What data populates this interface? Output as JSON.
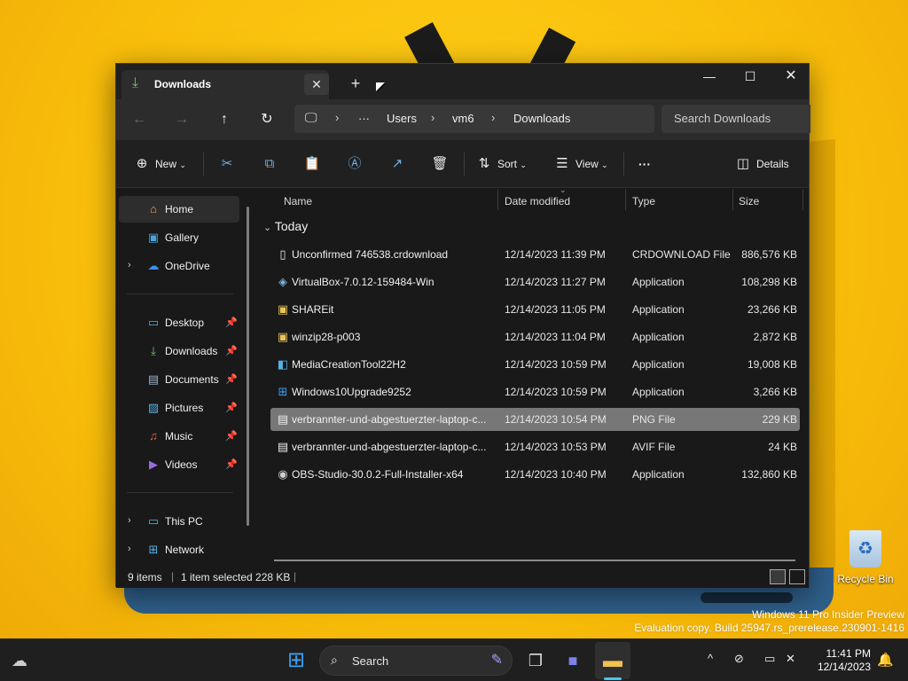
{
  "window": {
    "tab_title": "Downloads",
    "tab_close": "✕",
    "new_tab": "+",
    "minimize": "—",
    "maximize": "☐",
    "close": "✕"
  },
  "nav": {
    "back": "←",
    "forward": "→",
    "up": "↑",
    "refresh": "↻",
    "breadcrumb": [
      "Users",
      "vm6",
      "Downloads"
    ],
    "more": "···",
    "search_placeholder": "Search Downloads"
  },
  "toolbar": {
    "new_label": "New",
    "sort_label": "Sort",
    "view_label": "View",
    "more": "···",
    "details_label": "Details"
  },
  "sidebar": {
    "items": [
      {
        "label": "Home",
        "icon": "home-icon"
      },
      {
        "label": "Gallery",
        "icon": "gallery-icon"
      },
      {
        "label": "OneDrive",
        "icon": "cloud-icon"
      },
      {
        "label": "Desktop",
        "icon": "desktop-icon"
      },
      {
        "label": "Downloads",
        "icon": "download-icon"
      },
      {
        "label": "Documents",
        "icon": "document-icon"
      },
      {
        "label": "Pictures",
        "icon": "picture-icon"
      },
      {
        "label": "Music",
        "icon": "music-icon"
      },
      {
        "label": "Videos",
        "icon": "video-icon"
      },
      {
        "label": "This PC",
        "icon": "pc-icon"
      },
      {
        "label": "Network",
        "icon": "network-icon"
      }
    ]
  },
  "filelist": {
    "columns": [
      "Name",
      "Date modified",
      "Type",
      "Size"
    ],
    "group": "Today",
    "rows": [
      {
        "name": "Unconfirmed 746538.crdownload",
        "date": "12/14/2023 11:39 PM",
        "type": "CRDOWNLOAD File",
        "size": "886,576 KB"
      },
      {
        "name": "VirtualBox-7.0.12-159484-Win",
        "date": "12/14/2023 11:27 PM",
        "type": "Application",
        "size": "108,298 KB"
      },
      {
        "name": "SHAREit",
        "date": "12/14/2023 11:05 PM",
        "type": "Application",
        "size": "23,266 KB"
      },
      {
        "name": "winzip28-p003",
        "date": "12/14/2023 11:04 PM",
        "type": "Application",
        "size": "2,872 KB"
      },
      {
        "name": "MediaCreationTool22H2",
        "date": "12/14/2023 10:59 PM",
        "type": "Application",
        "size": "19,008 KB"
      },
      {
        "name": "Windows10Upgrade9252",
        "date": "12/14/2023 10:59 PM",
        "type": "Application",
        "size": "3,266 KB"
      },
      {
        "name": "verbrannter-und-abgestuerzter-laptop-c...",
        "date": "12/14/2023 10:54 PM",
        "type": "PNG File",
        "size": "229 KB"
      },
      {
        "name": "verbrannter-und-abgestuerzter-laptop-c...",
        "date": "12/14/2023 10:53 PM",
        "type": "AVIF File",
        "size": "24 KB"
      },
      {
        "name": "OBS-Studio-30.0.2-Full-Installer-x64",
        "date": "12/14/2023 10:40 PM",
        "type": "Application",
        "size": "132,860 KB"
      }
    ]
  },
  "status": {
    "count": "9 items",
    "selected": "1 item selected  228 KB"
  },
  "desktop": {
    "recycle_bin": "Recycle Bin",
    "watermark_line1": "Windows 11 Pro Insider Preview",
    "watermark_line2": "Evaluation copy. Build 25947.rs_prerelease.230901-1416"
  },
  "taskbar": {
    "search_label": "Search",
    "time": "11:41 PM",
    "date": "12/14/2023"
  },
  "colors": {
    "wallpaper": "#f8bd0a",
    "window_bg": "#191919",
    "accent": "#4cc2ff",
    "selected_row": "#777777"
  }
}
